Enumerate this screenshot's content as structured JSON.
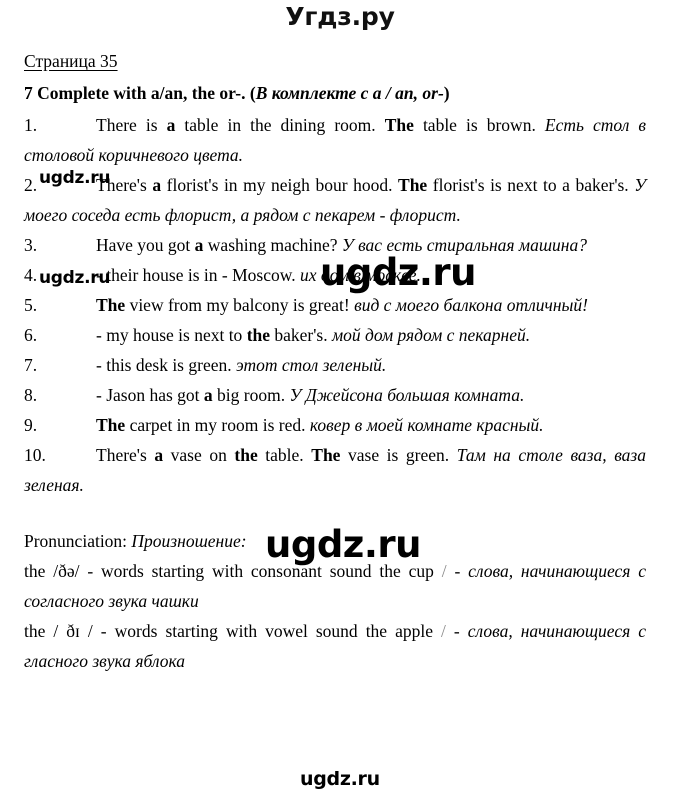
{
  "site": {
    "logo_top": "Угдз.ру",
    "watermark_text": "ugdz.ru"
  },
  "document": {
    "page_heading": "Страница 35",
    "task_number_and_title_en": "7 Complete with a/an, the or-. (",
    "task_title_ru": "В комплекте с a / an, or-",
    "task_title_close": ")"
  },
  "exercises": [
    {
      "num": "1.",
      "en_1": "There is ",
      "bold_1": "a",
      "en_2": " table in the dining room. ",
      "bold_2": "The",
      "en_3": " table is brown. ",
      "ru": "Есть стол в столовой коричневого цвета."
    },
    {
      "num": "2.",
      "en_1": "There's ",
      "bold_1": "a",
      "en_2": " florist's in my neigh bour hood. ",
      "bold_2": "The",
      "en_3": " florist's is next to a baker's. ",
      "ru": "У моего соседа есть флорист, а рядом с пекарем - флорист."
    },
    {
      "num": "3.",
      "en_1": "Have you got ",
      "bold_1": "a",
      "en_2": " washing machine? ",
      "bold_2": "",
      "en_3": "",
      "ru": "У вас есть стиральная машина?"
    },
    {
      "num": "4.",
      "en_1": "- their house is in - Moscow. ",
      "bold_1": "",
      "en_2": "",
      "bold_2": "",
      "en_3": "",
      "ru": "их дом в москве."
    },
    {
      "num": "5.",
      "en_1": "",
      "bold_1": "The",
      "en_2": " view from my balcony is great! ",
      "bold_2": "",
      "en_3": "",
      "ru": "вид с моего балкона отличный!"
    },
    {
      "num": "6.",
      "en_1": "- my house is next to ",
      "bold_1": "the",
      "en_2": " baker's. ",
      "bold_2": "",
      "en_3": "",
      "ru": "мой дом рядом с пекарней."
    },
    {
      "num": "7.",
      "en_1": "- this desk is green. ",
      "bold_1": "",
      "en_2": "",
      "bold_2": "",
      "en_3": "",
      "ru": "этот стол зеленый."
    },
    {
      "num": "8.",
      "en_1": "- Jason has got ",
      "bold_1": "a",
      "en_2": " big room. ",
      "bold_2": "",
      "en_3": "",
      "ru": "У Джейсона большая комната."
    },
    {
      "num": "9.",
      "en_1": "",
      "bold_1": "The",
      "en_2": " carpet in my room is red. ",
      "bold_2": "",
      "en_3": "",
      "ru": "ковер в моей комнате красный."
    },
    {
      "num": "10.",
      "en_1": "There's ",
      "bold_1": "a",
      "en_2": " vase on ",
      "bold_2": "the",
      "en_3": " table. ",
      "bold_3": "The",
      "en_4": " vase is green. ",
      "ru": "Там на столе ваза, ваза зеленая."
    }
  ],
  "pronunciation": {
    "label_en": "Pronunciation: ",
    "label_ru": "Произношение:",
    "lines": [
      {
        "en_before": "the ",
        "ipa": "/ðə/",
        "en_after": " - words starting with consonant sound the cup ",
        "slash": "/",
        "dash": " - ",
        "ru": "слова, начинающиеся с согласного звука чашки"
      },
      {
        "en_before": "the ",
        "ipa": "/ ðɪ /",
        "en_after": " - words starting with vowel sound the apple ",
        "slash": "/",
        "dash": " - ",
        "ru": "слова, начинающиеся с гласного звука яблока"
      }
    ]
  }
}
